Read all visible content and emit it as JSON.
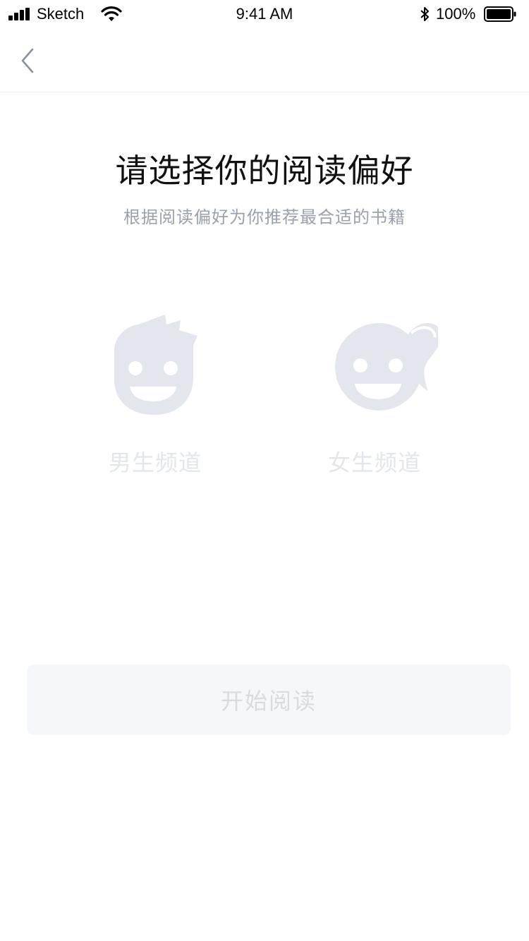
{
  "status_bar": {
    "carrier": "Sketch",
    "time": "9:41 AM",
    "battery_percent": "100%",
    "icons": [
      "signal-icon",
      "wifi-icon",
      "bluetooth-icon",
      "battery-icon"
    ]
  },
  "nav": {
    "back_icon": "chevron-left-icon"
  },
  "header": {
    "title": "请选择你的阅读偏好",
    "subtitle": "根据阅读偏好为你推荐最合适的书籍"
  },
  "channels": [
    {
      "label": "男生频道",
      "icon": "boy-face-icon"
    },
    {
      "label": "女生频道",
      "icon": "girl-face-icon"
    }
  ],
  "actions": {
    "start_label": "开始阅读"
  },
  "colors": {
    "title": "#111111",
    "subtitle": "#9aa0ad",
    "icon_placeholder": "#e3e6ec",
    "button_bg": "#f6f7fa",
    "button_text": "#d8dbe2",
    "back_icon": "#8a90a0"
  }
}
